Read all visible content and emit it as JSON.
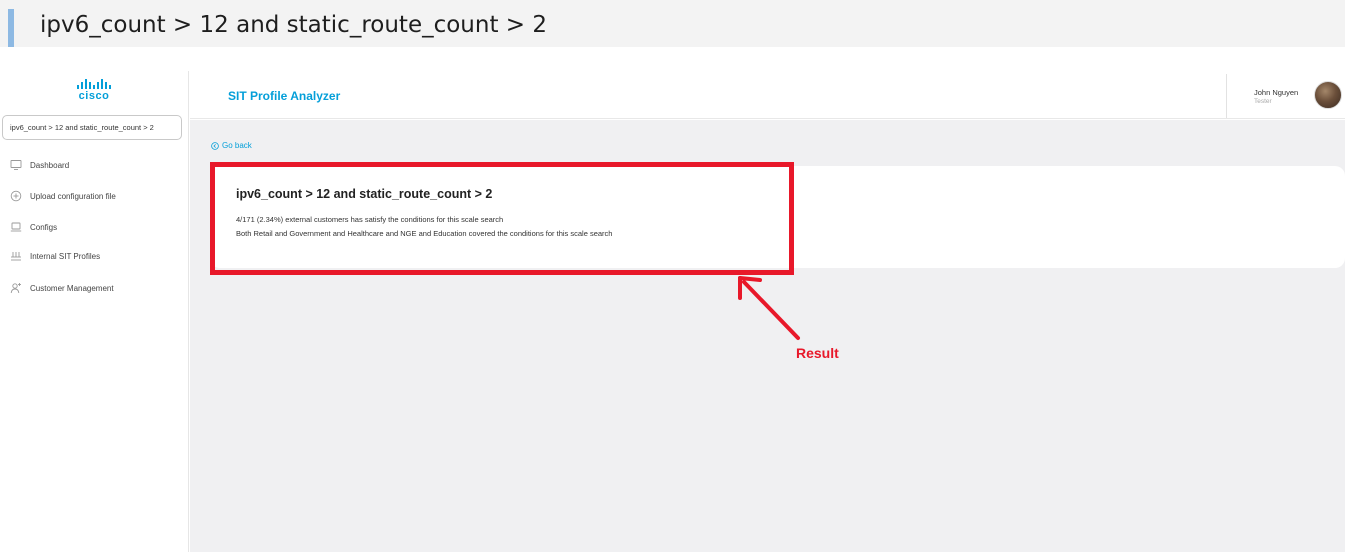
{
  "banner": {
    "text": "ipv6_count > 12 and static_route_count > 2"
  },
  "sidebar": {
    "logo_text": "cisco",
    "search_value": "ipv6_count > 12 and static_route_count > 2",
    "items": [
      {
        "label": "Dashboard",
        "icon": "monitor-icon"
      },
      {
        "label": "Upload configuration file",
        "icon": "plus-circle-icon"
      },
      {
        "label": "Configs",
        "icon": "laptop-icon"
      },
      {
        "label": "Internal SIT Profiles",
        "icon": "network-icon"
      },
      {
        "label": "Customer Management",
        "icon": "user-add-icon"
      }
    ]
  },
  "header": {
    "app_title": "SIT Profile Analyzer",
    "user_name": "John Nguyen",
    "user_role": "Tester"
  },
  "main": {
    "go_back_label": "Go back",
    "result": {
      "title": "ipv6_count > 12 and static_route_count > 2",
      "line1": "4/171 (2.34%) external customers has satisfy the conditions for this scale search",
      "line2": "Both Retail and Government and Healthcare and NGE and Education covered the conditions for this scale search"
    }
  },
  "annotation": {
    "label": "Result",
    "color": "#e8182a"
  },
  "colors": {
    "accent": "#049fd9",
    "background": "#f0f0f2"
  }
}
